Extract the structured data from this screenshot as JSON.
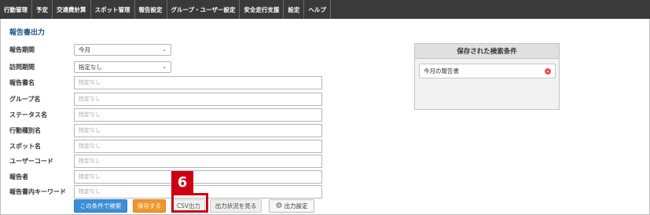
{
  "nav": {
    "items": [
      "行動管理",
      "予定",
      "交通費計算",
      "スポット管理",
      "報告設定",
      "グループ・ユーザー設定",
      "安全走行支援",
      "設定",
      "ヘルプ"
    ]
  },
  "page": {
    "title": "報告書出力"
  },
  "form": {
    "period": {
      "label": "報告期間",
      "value": "今月"
    },
    "visit_period": {
      "label": "訪問期間",
      "value": "指定なし"
    },
    "fields": [
      {
        "label": "報告書名",
        "placeholder": "指定なし"
      },
      {
        "label": "グループ名",
        "placeholder": "指定なし"
      },
      {
        "label": "ステータス名",
        "placeholder": "指定なし"
      },
      {
        "label": "行動種別名",
        "placeholder": "指定なし"
      },
      {
        "label": "スポット名",
        "placeholder": "指定なし"
      },
      {
        "label": "ユーザーコード",
        "placeholder": "指定なし"
      },
      {
        "label": "報告者",
        "placeholder": "指定なし"
      },
      {
        "label": "報告書内キーワード",
        "placeholder": "指定なし"
      }
    ]
  },
  "buttons": {
    "search": "この条件で検索",
    "save": "保存する",
    "csv": "CSV出力",
    "status": "出力状況を見る",
    "settings": "出力設定"
  },
  "callout": {
    "number": "6"
  },
  "saved_panel": {
    "title": "保存された検索条件",
    "items": [
      "今月の報告書"
    ]
  },
  "icons": {
    "chevron": "chevron-down-icon",
    "gear": "gear-icon",
    "remove": "minus-circle-icon"
  },
  "colors": {
    "nav_bg": "#3a3a3a",
    "title": "#1a4f87",
    "search_button": "#3b8fd8",
    "save_button": "#f0962a",
    "callout": "#cc0012",
    "remove_icon": "#e8504a"
  }
}
